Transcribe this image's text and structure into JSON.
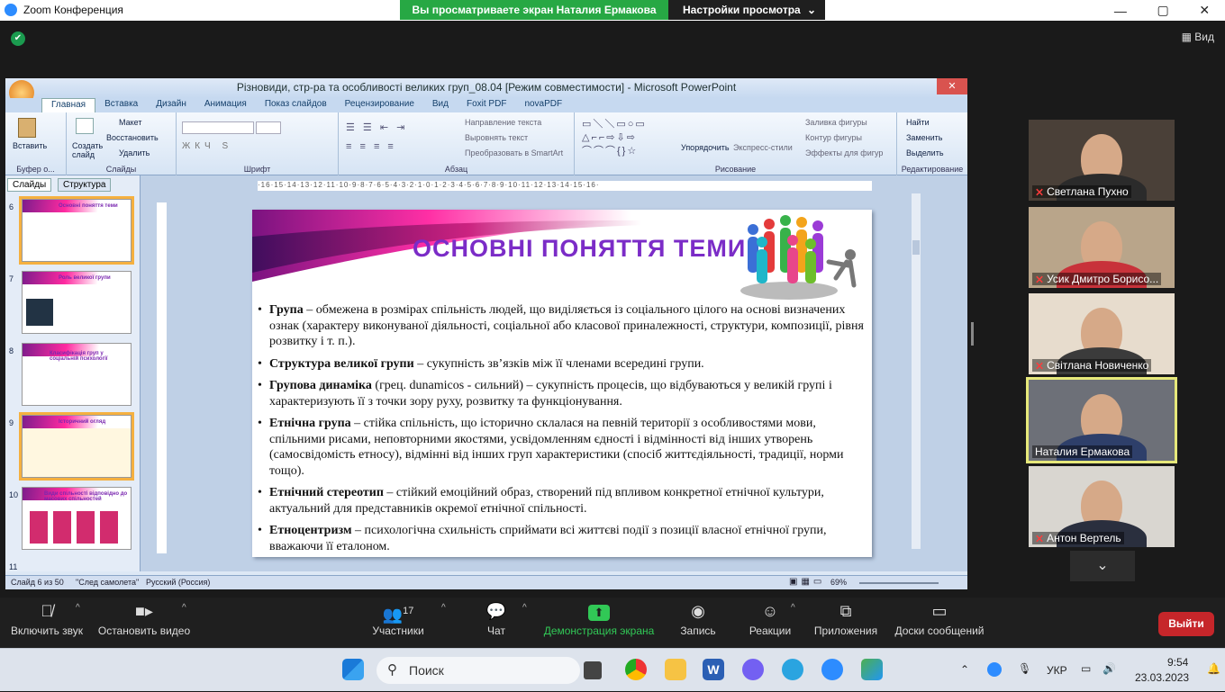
{
  "zoom": {
    "app_title": "Zoom Конференция",
    "share_banner": "Вы просматриваете экран Наталия Ермакова",
    "view_options": "Настройки просмотра",
    "view_label": "Вид"
  },
  "ppt": {
    "title": "Різновиди, стр-ра та особливості великих груп_08.04 [Режим совместимости] - Microsoft PowerPoint",
    "tabs": [
      "Главная",
      "Вставка",
      "Дизайн",
      "Анимация",
      "Показ слайдов",
      "Рецензирование",
      "Вид",
      "Foxit PDF",
      "novaPDF"
    ],
    "ribbon": {
      "clipboard": {
        "paste": "Вставить",
        "label": "Буфер о..."
      },
      "slides": {
        "create": "Создать слайд",
        "layout": "Макет",
        "reset": "Восстановить",
        "delete": "Удалить",
        "label": "Слайды"
      },
      "font": {
        "label": "Шрифт"
      },
      "paragraph": {
        "direction": "Направление текста",
        "align": "Выровнять текст",
        "smartart": "Преобразовать в SmartArt",
        "label": "Абзац"
      },
      "drawing": {
        "arrange": "Упорядочить",
        "styles": "Экспресс-стили",
        "fill": "Заливка фигуры",
        "outline": "Контур фигуры",
        "effects": "Эффекты для фигур",
        "label": "Рисование"
      },
      "editing": {
        "find": "Найти",
        "replace": "Заменить",
        "select": "Выделить",
        "label": "Редактирование"
      }
    },
    "panel_tabs": [
      "Слайды",
      "Структура"
    ],
    "thumbs": [
      {
        "num": "6",
        "title": "Основні поняття теми"
      },
      {
        "num": "7",
        "title": "Роль великої групи"
      },
      {
        "num": "8",
        "title": "Класифікація груп у соціальній психології"
      },
      {
        "num": "9",
        "title": "Історичний огляд"
      },
      {
        "num": "10",
        "title": "Види спільності відповідно до масових спільностей"
      },
      {
        "num": "11",
        "title": ""
      }
    ],
    "ruler": "·16·15·14·13·12·11·10·9·8·7·6·5·4·3·2·1·0·1·2·3·4·5·6·7·8·9·10·11·12·13·14·15·16·",
    "slide": {
      "title": "ОСНОВНІ ПОНЯТТЯ ТЕМИ",
      "bullets": [
        {
          "term": "Група",
          "text": " – обмежена в розмірах спільність людей, що виділяється із соціального цілого на основі визначених ознак (характеру виконуваної діяльності, соціальної або класової приналежності, структури, композиції, рівня розвитку і т. п.)."
        },
        {
          "term": "Структура великої групи",
          "text": " – сукупність зв’язків між її членами всередині групи."
        },
        {
          "term": "Групова динаміка",
          "text": " (грец. dunamicos - сильний) – сукупність процесів, що відбуваються у великій групі і характеризують її з точки зору руху, розвитку та функціонування."
        },
        {
          "term": "Етнічна група",
          "text": " – стійка спільність, що історично склалася на певній території з особливостями мови, спільними рисами, неповторними якостями, усвідомленням єдності і відмінності від інших утворень (самосвідомість етносу), відмінні від інших груп характеристики (спосіб життєдіяльності, традиції, норми тощо)."
        },
        {
          "term": "Етнічний стереотип",
          "text": " – стійкий емоційний образ, створений під впливом конкретної етнічної культури, актуальний для представників окремої етнічної спільності."
        },
        {
          "term": "Етноцентризм",
          "text": " – психологічна схильність сприймати всі життєві події з позиції власної етнічної групи, вважаючи її еталоном."
        }
      ]
    },
    "status": {
      "slide": "Слайд 6 из 50",
      "theme": "\"След самолета\"",
      "lang": "Русский (Россия)",
      "zoom": "69%"
    }
  },
  "participants": [
    {
      "name": "Светлана Пухно",
      "muted": true,
      "bg": "#4a4038",
      "shirt": "#2b2b2b"
    },
    {
      "name": "Усик Дмитро Борисо...",
      "muted": true,
      "bg": "#b9a58a",
      "shirt": "#c8323a"
    },
    {
      "name": "Світлана Новиченко",
      "muted": true,
      "bg": "#e7dccd",
      "shirt": "#3b3b3b"
    },
    {
      "name": "Наталия Ермакова",
      "muted": false,
      "bg": "#6d7078",
      "shirt": "#2e3f6a"
    },
    {
      "name": "Антон Вертель",
      "muted": true,
      "bg": "#d9d6d0",
      "shirt": "#2a2f3e"
    }
  ],
  "toolbar": {
    "unmute": "Включить звук",
    "video": "Остановить видео",
    "participants": "Участники",
    "participants_count": "17",
    "chat": "Чат",
    "share": "Демонстрация экрана",
    "record": "Запись",
    "reactions": "Реакции",
    "apps": "Приложения",
    "whiteboards": "Доски сообщений",
    "end": "Выйти"
  },
  "taskbar": {
    "search": "Поиск",
    "lang": "УКР",
    "time": "9:54",
    "date": "23.03.2023"
  }
}
